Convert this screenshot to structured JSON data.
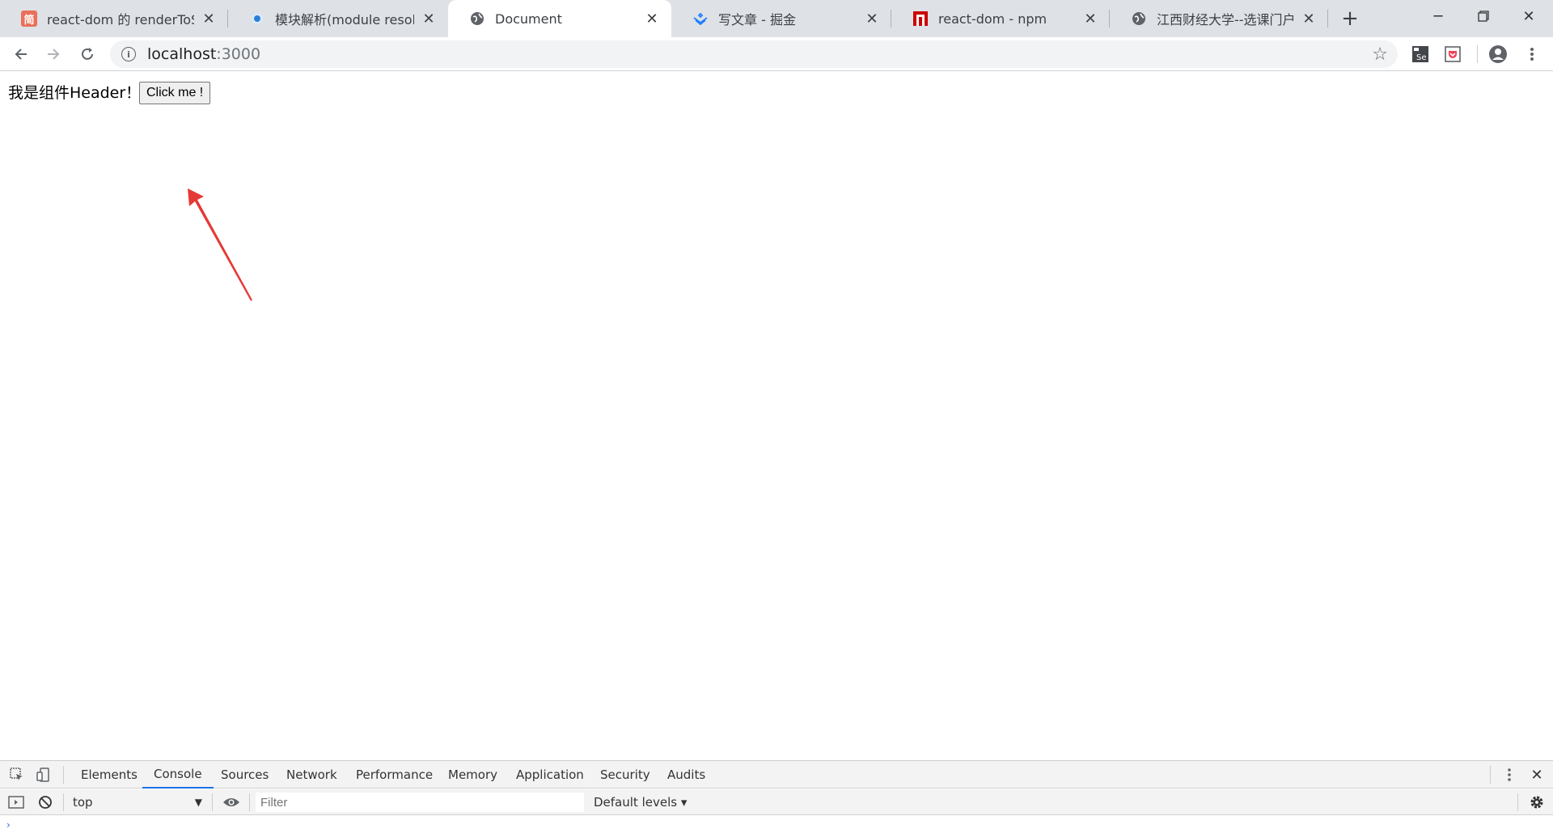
{
  "browser": {
    "tabs": [
      {
        "title": "react-dom 的 renderToStri",
        "icon": "jianshu-icon",
        "color": "#ea6f5a"
      },
      {
        "title": "模块解析(module resolution",
        "icon": "typescript-icon",
        "color": "#2b7fd8"
      },
      {
        "title": "Document",
        "icon": "globe-icon",
        "active": true
      },
      {
        "title": "写文章 - 掘金",
        "icon": "juejin-icon",
        "color": "#1e80ff"
      },
      {
        "title": "react-dom - npm",
        "icon": "npm-icon",
        "color": "#cb0000"
      },
      {
        "title": "江西财经大学--选课门户平台",
        "icon": "globe-icon"
      }
    ],
    "address": {
      "host": "localhost",
      "port": ":3000"
    },
    "extensions": [
      "selenium-icon",
      "pocket-icon",
      "account-icon"
    ]
  },
  "page": {
    "header_text": "我是组件Header！",
    "button_label": "Click me !"
  },
  "devtools": {
    "tabs": [
      "Elements",
      "Console",
      "Sources",
      "Network",
      "Performance",
      "Memory",
      "Application",
      "Security",
      "Audits"
    ],
    "active_tab": "Console",
    "context": "top",
    "filter_placeholder": "Filter",
    "levels": "Default levels ▾"
  },
  "colors": {
    "accent": "#1a73e8",
    "arrow": "#e53935"
  }
}
